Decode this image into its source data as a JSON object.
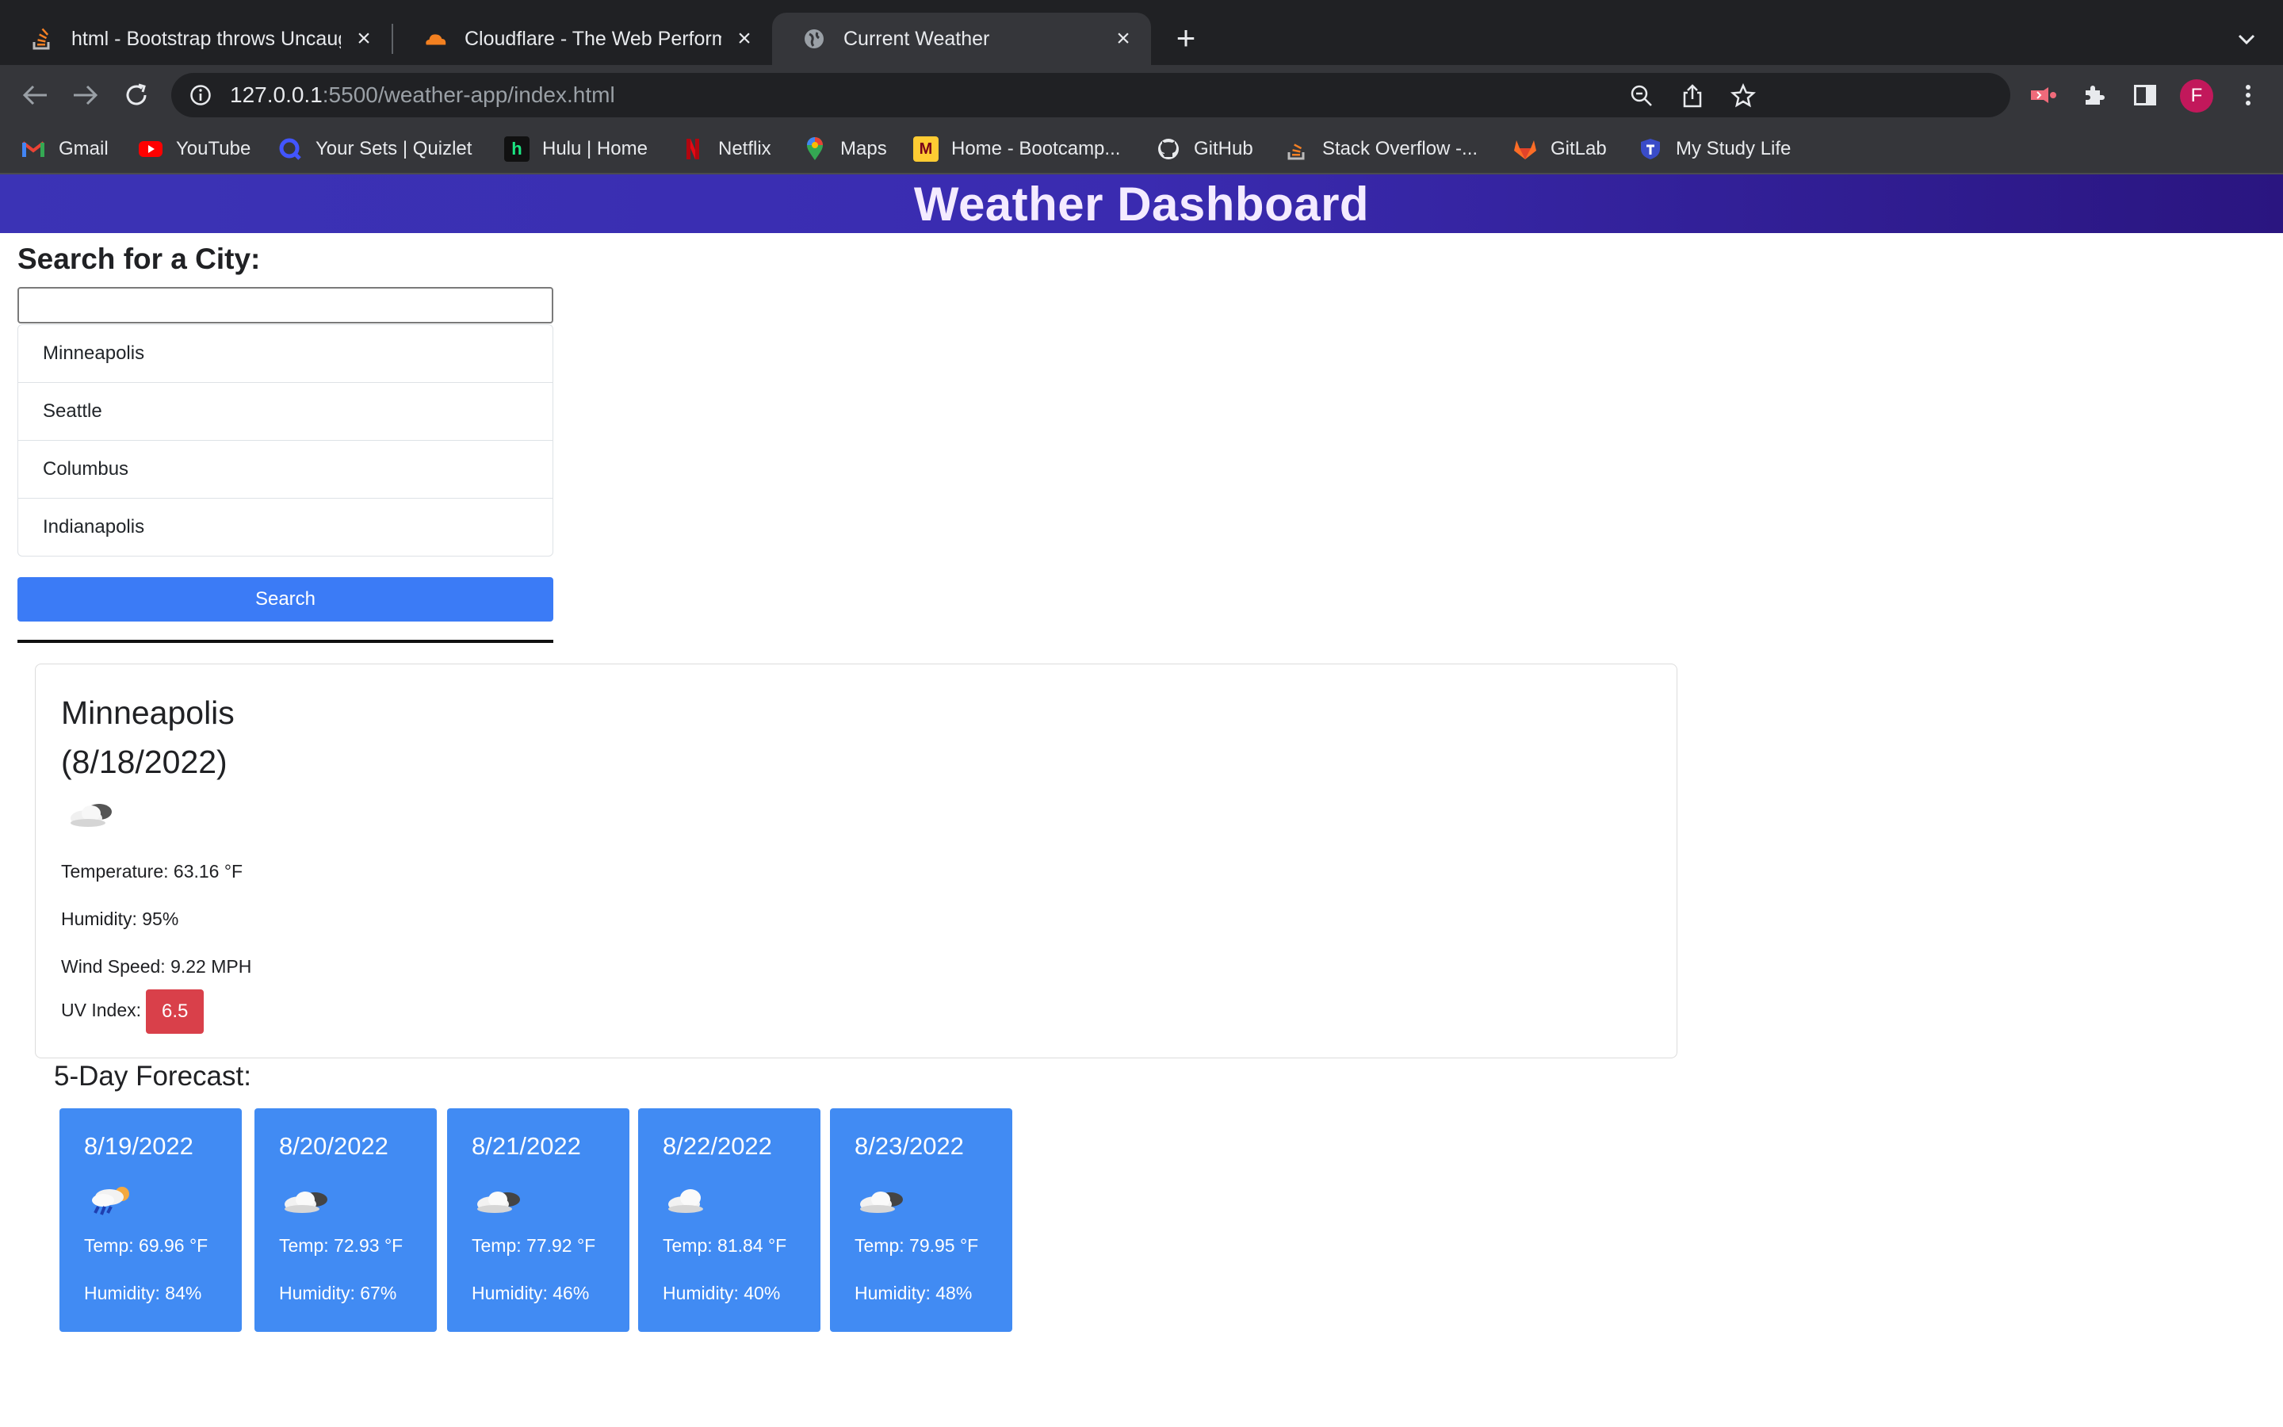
{
  "browser": {
    "tabs": [
      {
        "title": "html - Bootstrap throws Uncaught TypeError",
        "icon": "stackoverflow-icon",
        "active": false
      },
      {
        "title": "Cloudflare - The Web Performance & Security Company",
        "icon": "cloudflare-icon",
        "active": false
      },
      {
        "title": "Current Weather",
        "icon": "globe-icon",
        "active": true
      }
    ],
    "url_host": "127.0.0.1",
    "url_rest": ":5500/weather-app/index.html",
    "profile_initial": "F",
    "bookmarks": [
      {
        "label": "Gmail",
        "icon": "gmail-icon"
      },
      {
        "label": "YouTube",
        "icon": "youtube-icon"
      },
      {
        "label": "Your Sets | Quizlet",
        "icon": "quizlet-icon"
      },
      {
        "label": "Hulu | Home",
        "icon": "hulu-icon"
      },
      {
        "label": "Netflix",
        "icon": "netflix-icon"
      },
      {
        "label": "Maps",
        "icon": "maps-icon"
      },
      {
        "label": "Home - Bootcamp...",
        "icon": "bootcamp-icon"
      },
      {
        "label": "GitHub",
        "icon": "github-icon"
      },
      {
        "label": "Stack Overflow -...",
        "icon": "stackoverflow-icon"
      },
      {
        "label": "GitLab",
        "icon": "gitlab-icon"
      },
      {
        "label": "My Study Life",
        "icon": "mystudylife-icon"
      }
    ]
  },
  "page": {
    "title": "Weather Dashboard",
    "search": {
      "heading": "Search for a City:",
      "value": "",
      "history": [
        "Minneapolis",
        "Seattle",
        "Columbus",
        "Indianapolis"
      ],
      "button_label": "Search"
    },
    "current": {
      "city": "Minneapolis",
      "date": "(8/18/2022)",
      "icon": "cloud-icon",
      "temperature": "Temperature: 63.16 °F",
      "humidity": "Humidity: 95%",
      "wind": "Wind Speed: 9.22 MPH",
      "uv_label": "UV Index:",
      "uv_value": "6.5",
      "uv_color": "#d9404a"
    },
    "forecast_heading": "5-Day Forecast:",
    "forecast": [
      {
        "date": "8/19/2022",
        "icon": "rain-sun-icon",
        "temp": "Temp: 69.96 °F",
        "humidity": "Humidity: 84%"
      },
      {
        "date": "8/20/2022",
        "icon": "cloud-icon",
        "temp": "Temp: 72.93 °F",
        "humidity": "Humidity: 67%"
      },
      {
        "date": "8/21/2022",
        "icon": "cloud-icon",
        "temp": "Temp: 77.92 °F",
        "humidity": "Humidity: 46%"
      },
      {
        "date": "8/22/2022",
        "icon": "cloud-light-icon",
        "temp": "Temp: 81.84 °F",
        "humidity": "Humidity: 40%"
      },
      {
        "date": "8/23/2022",
        "icon": "cloud-icon",
        "temp": "Temp: 79.95 °F",
        "humidity": "Humidity: 48%"
      }
    ],
    "colors": {
      "header_start": "#3b33b5",
      "header_end": "#2a1580",
      "accent": "#3b7bf6",
      "forecast_card": "#418bf3"
    }
  }
}
